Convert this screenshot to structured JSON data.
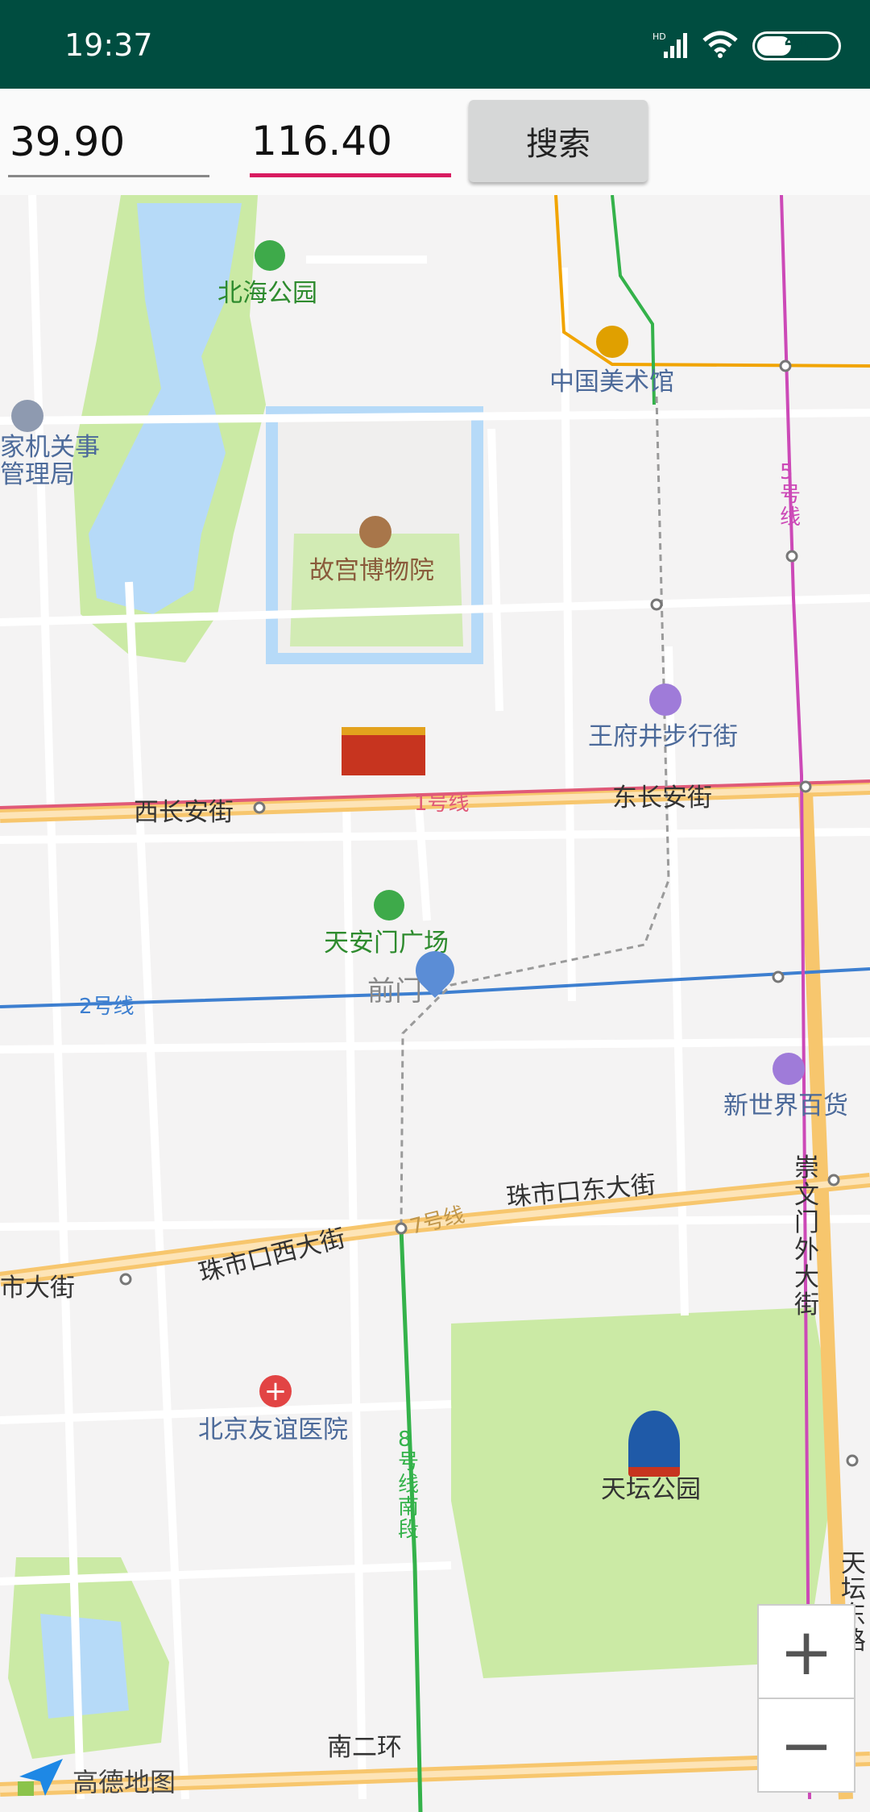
{
  "status": {
    "time": "19:37",
    "network": "HD",
    "battery": "41"
  },
  "search": {
    "lat_value": "39.90",
    "lon_value": "116.40",
    "button_label": "搜索"
  },
  "map": {
    "pois": [
      {
        "key": "beihai",
        "label": "北海公园",
        "icon": "park-icon"
      },
      {
        "key": "artmuseum",
        "label": "中国美术馆",
        "icon": "museum-icon"
      },
      {
        "key": "palace",
        "label": "故宫博物院",
        "icon": "museum-icon"
      },
      {
        "key": "wangfujing",
        "label": "王府井步行街",
        "icon": "shopping-icon"
      },
      {
        "key": "square",
        "label": "天安门广场",
        "icon": "park-icon"
      },
      {
        "key": "newworld",
        "label": "新世界百货",
        "icon": "shopping-icon"
      },
      {
        "key": "hospital",
        "label": "北京友谊医院",
        "icon": "hospital-icon"
      },
      {
        "key": "temple",
        "label": "天坛公园",
        "icon": "temple-of-heaven-icon"
      },
      {
        "key": "agency",
        "label": "家机关事\n管理局",
        "icon": "star-icon"
      }
    ],
    "roads": [
      "西长安街",
      "东长安街",
      "珠市口东大街",
      "珠市口西大街",
      "市大街",
      "崇文门外大街",
      "天坛东路",
      "南二环"
    ],
    "metro": [
      "1号线",
      "2号线",
      "5号线",
      "7号线",
      "8号线南段"
    ],
    "marker_label": "前门"
  },
  "zoom": {
    "in": "+",
    "out": "−"
  },
  "logo": "高德地图"
}
